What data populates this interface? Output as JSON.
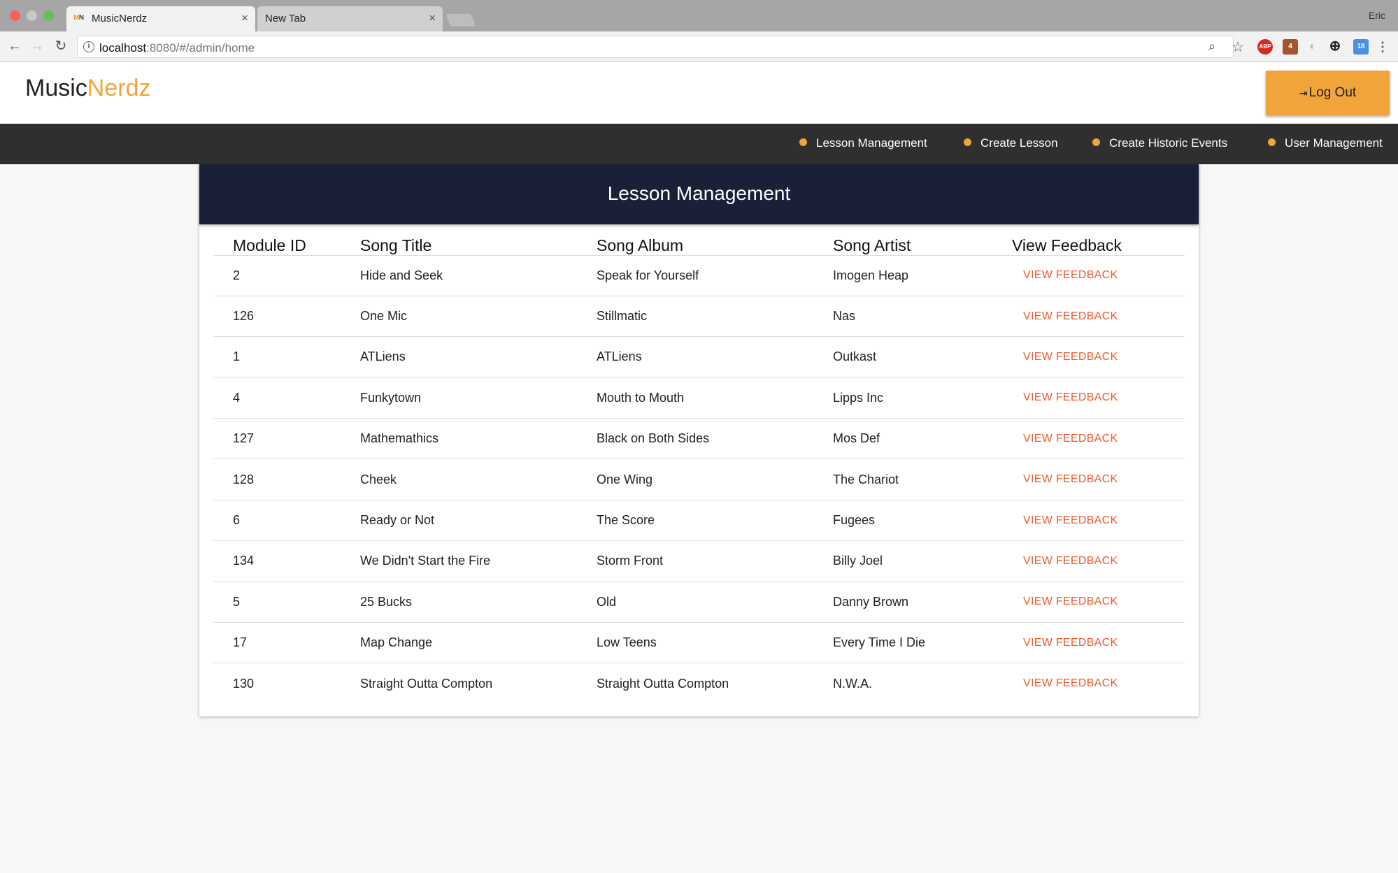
{
  "browser": {
    "tabs": [
      {
        "favicon": "MN",
        "title": "MusicNerdz"
      },
      {
        "title": "New Tab"
      }
    ],
    "profile": "Eric",
    "url_host": "localhost",
    "url_path": ":8080/#/admin/home",
    "extensions": [
      "ABP",
      "4",
      "18"
    ]
  },
  "header": {
    "logo_part1": "Music",
    "logo_part2": "Nerdz",
    "logout_label": "Log Out"
  },
  "nav": [
    "Lesson Management",
    "Create Lesson",
    "Create Historic Events",
    "User Management"
  ],
  "panel": {
    "title": "Lesson Management",
    "columns": [
      "Module ID",
      "Song Title",
      "Song Album",
      "Song Artist",
      "View Feedback"
    ],
    "feedback_label": "VIEW FEEDBACK",
    "rows": [
      {
        "id": "2",
        "title": "Hide and Seek",
        "album": "Speak for Yourself",
        "artist": "Imogen Heap"
      },
      {
        "id": "126",
        "title": "One Mic",
        "album": "Stillmatic",
        "artist": "Nas"
      },
      {
        "id": "1",
        "title": "ATLiens",
        "album": "ATLiens",
        "artist": "Outkast"
      },
      {
        "id": "4",
        "title": "Funkytown",
        "album": "Mouth to Mouth",
        "artist": "Lipps Inc"
      },
      {
        "id": "127",
        "title": "Mathemathics",
        "album": "Black on Both Sides",
        "artist": "Mos Def"
      },
      {
        "id": "128",
        "title": "Cheek",
        "album": "One Wing",
        "artist": "The Chariot"
      },
      {
        "id": "6",
        "title": "Ready or Not",
        "album": "The Score",
        "artist": "Fugees"
      },
      {
        "id": "134",
        "title": "We Didn't Start the Fire",
        "album": "Storm Front",
        "artist": "Billy Joel"
      },
      {
        "id": "5",
        "title": "25 Bucks",
        "album": "Old",
        "artist": "Danny Brown"
      },
      {
        "id": "17",
        "title": "Map Change",
        "album": "Low Teens",
        "artist": "Every Time I Die"
      },
      {
        "id": "130",
        "title": "Straight Outta Compton",
        "album": "Straight Outta Compton",
        "artist": "N.W.A."
      }
    ]
  },
  "colors": {
    "accent": "#f0a43a",
    "panel_header": "#192038",
    "navbar": "#2f2f2f",
    "link": "#ef5a2b"
  }
}
